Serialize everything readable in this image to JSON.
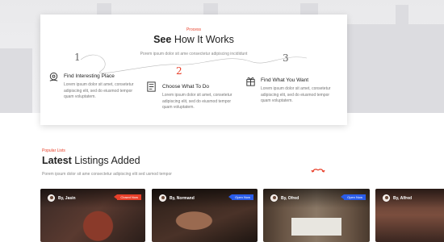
{
  "how_it_works": {
    "tag": "Process",
    "title_bold": "See",
    "title_rest": " How It Works",
    "subtitle": "Porem ipsum dolor sit ame consectetur adipiscing incididunt",
    "steps": [
      {
        "number": "1",
        "title": "Find Interesting Place",
        "lines": [
          "Lorem ipsum dolor sit amet, consetetur",
          "adipiscing elit, sed do eiusmod tempor",
          "quam voluptatem."
        ]
      },
      {
        "number": "2",
        "title": "Choose What To Do",
        "lines": [
          "Lorem ipsum dolor sit amet, consetetur",
          "adipiscing elit, sed do eiusmod tempor",
          "quam voluptatem."
        ]
      },
      {
        "number": "3",
        "title": "Find What You Want",
        "lines": [
          "Lorem ipsum dolor sit amet, consetetur",
          "adipiscing elit, sed do eiusmod tempor",
          "quam voluptatem."
        ]
      }
    ]
  },
  "listings": {
    "tag": "Popular Lists",
    "title_bold": "Latest",
    "title_rest": " Listings Added",
    "subtitle": "Porem ipsum dolor sit ame consectetur adipiscing elit sed usmod tempor",
    "cards": [
      {
        "author": "By, Jasin",
        "status": "Closed Now"
      },
      {
        "author": "By, Normand",
        "status": "Open Now"
      },
      {
        "author": "By, Ofred",
        "status": "Open Now"
      },
      {
        "author": "By, Alfred",
        "status": ""
      }
    ]
  },
  "colors": {
    "accent": "#e8402a",
    "open_badge": "#2a5ce8"
  }
}
